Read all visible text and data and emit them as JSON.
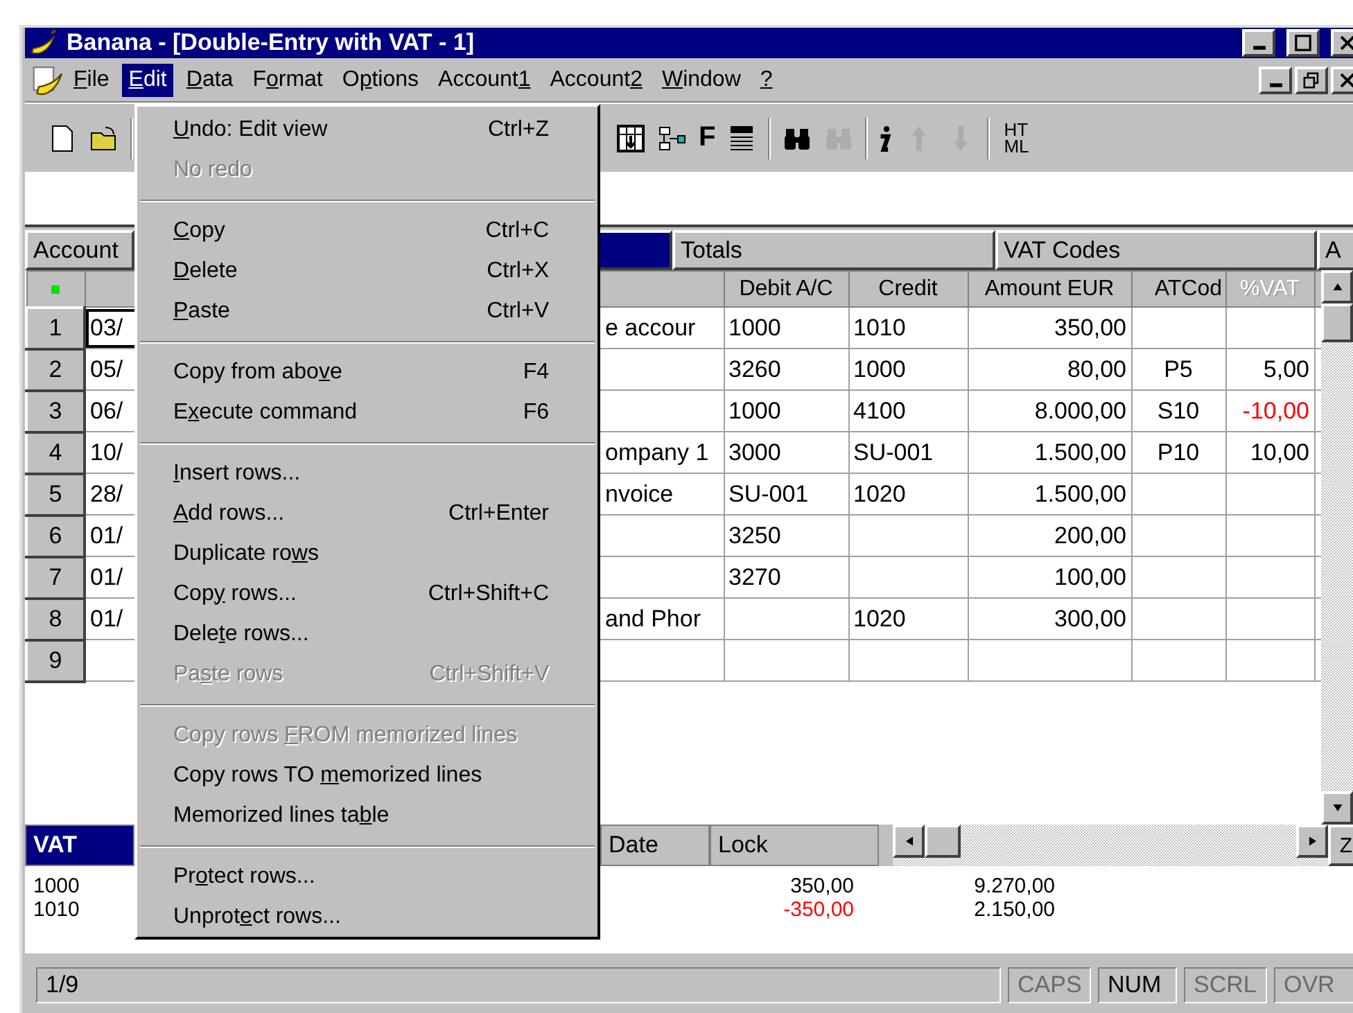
{
  "window": {
    "title": "Banana - [Double-Entry with VAT - 1]"
  },
  "menubar": [
    {
      "label": {
        "key": "F",
        "post": "ile"
      },
      "selected": false
    },
    {
      "label": {
        "key": "E",
        "post": "dit"
      },
      "selected": true
    },
    {
      "label": {
        "key": "D",
        "post": "ata"
      },
      "selected": false
    },
    {
      "label": {
        "pre": "F",
        "key": "o",
        "post": "rmat"
      },
      "selected": false
    },
    {
      "label": {
        "pre": "O",
        "key": "p",
        "post": "tions"
      },
      "selected": false
    },
    {
      "label": {
        "pre": "Account",
        "key": "1"
      },
      "selected": false
    },
    {
      "label": {
        "pre": "Account",
        "key": "2"
      },
      "selected": false
    },
    {
      "label": {
        "key": "W",
        "post": "indow"
      },
      "selected": false
    },
    {
      "label": {
        "key": "?"
      },
      "selected": false
    }
  ],
  "toolbar": [
    {
      "kind": "new",
      "disabled": false
    },
    {
      "kind": "open",
      "disabled": false
    },
    {
      "kind": "separator"
    },
    {
      "kind": "insert_row",
      "disabled": false
    },
    {
      "kind": "link",
      "disabled": false
    },
    {
      "kind": "font",
      "label": "F",
      "disabled": false
    },
    {
      "kind": "list",
      "disabled": false
    },
    {
      "kind": "separator"
    },
    {
      "kind": "find",
      "disabled": false
    },
    {
      "kind": "find",
      "disabled": true
    },
    {
      "kind": "separator"
    },
    {
      "kind": "info",
      "disabled": false
    },
    {
      "kind": "up",
      "disabled": true
    },
    {
      "kind": "down",
      "disabled": true
    },
    {
      "kind": "separator"
    },
    {
      "kind": "html",
      "lines": [
        "HT",
        "ML"
      ],
      "disabled": false
    }
  ],
  "tabs": [
    {
      "label": "Account",
      "selected": false
    },
    {
      "selected": true
    },
    {
      "label": "Totals",
      "selected": false
    },
    {
      "label": "VAT Codes",
      "selected": false
    },
    {
      "label": "A",
      "selected": false
    }
  ],
  "table": {
    "columns": [
      {
        "label": "Debit A/C",
        "disabled": false
      },
      {
        "label": "Credit",
        "disabled": false
      },
      {
        "label": "Amount EUR",
        "disabled": false
      },
      {
        "label": "ATCod",
        "disabled": false
      },
      {
        "label": "%VAT",
        "disabled": true
      }
    ],
    "rows": [
      {
        "num": "1",
        "current": true,
        "date": "03/",
        "description": "e accour",
        "debit": "1000",
        "credit": "1010",
        "amount": "350,00"
      },
      {
        "num": "2",
        "current": false,
        "date": "05/",
        "debit": "3260",
        "credit": "1000",
        "amount": "80,00",
        "vat_code": "P5",
        "vat_pct": "5,00",
        "pct_negative": false
      },
      {
        "num": "3",
        "current": false,
        "date": "06/",
        "debit": "1000",
        "credit": "4100",
        "amount": "8.000,00",
        "vat_code": "S10",
        "vat_pct": "-10,00",
        "pct_negative": true
      },
      {
        "num": "4",
        "current": false,
        "date": "10/",
        "description": "ompany 1",
        "debit": "3000",
        "credit": "SU-001",
        "amount": "1.500,00",
        "vat_code": "P10",
        "vat_pct": "10,00",
        "pct_negative": false
      },
      {
        "num": "5",
        "current": false,
        "date": "28/",
        "description": "nvoice",
        "debit": "SU-001",
        "credit": "1020",
        "amount": "1.500,00"
      },
      {
        "num": "6",
        "current": false,
        "date": "01/",
        "debit": "3250",
        "amount": "200,00"
      },
      {
        "num": "7",
        "current": false,
        "date": "01/",
        "debit": "3270",
        "amount": "100,00"
      },
      {
        "num": "8",
        "current": false,
        "date": "01/",
        "description": "and Phor",
        "credit": "1020",
        "amount": "300,00"
      },
      {
        "num": "9",
        "current": false
      }
    ]
  },
  "bottom_tabs": [
    {
      "label": "VAT",
      "selected": true
    },
    {
      "label": "Date",
      "selected": false
    },
    {
      "label": "Lock",
      "selected": false
    }
  ],
  "corner_label": "Z",
  "info_lines": [
    {
      "account": "1000",
      "amount": "350,00",
      "negative": false,
      "balance": "9.270,00"
    },
    {
      "account": "1010",
      "amount": "-350,00",
      "negative": true,
      "balance": "2.150,00"
    }
  ],
  "status_bar": {
    "position": "1/9",
    "indicators": [
      {
        "label": "CAPS",
        "on": false
      },
      {
        "label": "NUM",
        "on": true
      },
      {
        "label": "SCRL",
        "on": false
      },
      {
        "label": "OVR",
        "on": false
      }
    ]
  },
  "edit_menu": [
    {
      "kind": "item",
      "label": {
        "key": "U",
        "post": "ndo: Edit view"
      },
      "shortcut": "Ctrl+Z",
      "disabled": false
    },
    {
      "kind": "item",
      "label": {
        "pre": "No redo"
      },
      "disabled": true
    },
    {
      "kind": "separator"
    },
    {
      "kind": "item",
      "label": {
        "key": "C",
        "post": "opy"
      },
      "shortcut": "Ctrl+C",
      "disabled": false
    },
    {
      "kind": "item",
      "label": {
        "key": "D",
        "post": "elete"
      },
      "shortcut": "Ctrl+X",
      "disabled": false
    },
    {
      "kind": "item",
      "label": {
        "key": "P",
        "post": "aste"
      },
      "shortcut": "Ctrl+V",
      "disabled": false
    },
    {
      "kind": "separator"
    },
    {
      "kind": "item",
      "label": {
        "pre": "Copy from abo",
        "key": "v",
        "post": "e"
      },
      "shortcut": "F4",
      "disabled": false
    },
    {
      "kind": "item",
      "label": {
        "pre": "E",
        "key": "x",
        "post": "ecute command"
      },
      "shortcut": "F6",
      "disabled": false
    },
    {
      "kind": "separator"
    },
    {
      "kind": "item",
      "label": {
        "key": "I",
        "post": "nsert rows..."
      },
      "disabled": false
    },
    {
      "kind": "item",
      "label": {
        "key": "A",
        "post": "dd rows..."
      },
      "shortcut": "Ctrl+Enter",
      "disabled": false
    },
    {
      "kind": "item",
      "label": {
        "pre": "Duplicate ro",
        "key": "w",
        "post": "s"
      },
      "disabled": false
    },
    {
      "kind": "item",
      "label": {
        "pre": "Cop",
        "key": "y",
        "post": " rows..."
      },
      "shortcut": "Ctrl+Shift+C",
      "disabled": false
    },
    {
      "kind": "item",
      "label": {
        "pre": "Dele",
        "key": "t",
        "post": "e rows..."
      },
      "disabled": false
    },
    {
      "kind": "item",
      "label": {
        "pre": "Pa",
        "key": "s",
        "post": "te rows"
      },
      "shortcut": "Ctrl+Shift+V",
      "disabled": true
    },
    {
      "kind": "separator"
    },
    {
      "kind": "item",
      "label": {
        "pre": "Copy rows ",
        "key": "F",
        "post": "ROM memorized lines"
      },
      "disabled": true
    },
    {
      "kind": "item",
      "label": {
        "pre": "Copy rows TO ",
        "key": "m",
        "post": "emorized lines"
      },
      "disabled": false
    },
    {
      "kind": "item",
      "label": {
        "pre": "Memorized lines ta",
        "key": "b",
        "post": "le"
      },
      "disabled": false
    },
    {
      "kind": "separator"
    },
    {
      "kind": "item",
      "label": {
        "pre": "Pr",
        "key": "o",
        "post": "tect rows..."
      },
      "disabled": false
    },
    {
      "kind": "item",
      "label": {
        "pre": "Unprot",
        "key": "e",
        "post": "ct rows..."
      },
      "disabled": false
    }
  ]
}
